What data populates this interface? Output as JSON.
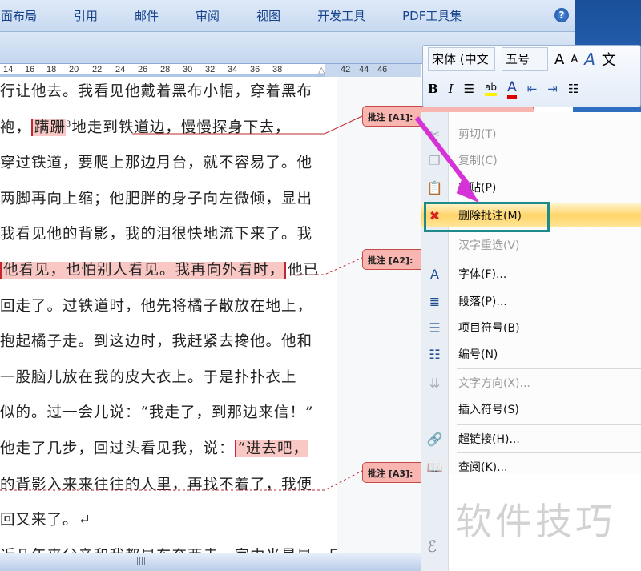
{
  "ribbon": {
    "tabs": [
      "页面布局",
      "引用",
      "邮件",
      "审阅",
      "视图",
      "开发工具",
      "PDF工具集"
    ],
    "help": "?"
  },
  "ruler": {
    "ticks": [
      "14",
      "16",
      "18",
      "20",
      "22",
      "24",
      "26",
      "28",
      "30",
      "32",
      "34",
      "36",
      "38",
      "42",
      "44",
      "46"
    ]
  },
  "document": {
    "lines": [
      {
        "pre": "行让他去。我看见他戴着黑布小帽，穿着黑布"
      },
      {
        "pre": "袍，",
        "hl": "蹒跚",
        "sup": "3",
        "post": "地走到铁道边，慢慢探身下去，"
      },
      {
        "pre": "穿过铁道，要爬上那边月台，就不容易了。他"
      },
      {
        "pre": "两脚再向上缩；他肥胖的身子向左微倾，显出"
      },
      {
        "pre": "我看见他的背影，我的泪很快地流下来了。我"
      },
      {
        "hl": "他看见，也怕别人看见。我再向外看时，",
        "post": "他已"
      },
      {
        "pre": "回走了。过铁道时，他先将橘子散放在地上，"
      },
      {
        "pre": "抱起橘子走。到这边时，我赶紧去搀他。他和"
      },
      {
        "pre": "一股脑儿放在我的皮大衣上。于是扑扑衣上"
      },
      {
        "pre": "似的。过一会儿说：“我走了，到那边来信！”"
      },
      {
        "pre": "他走了几步，回过头看见我，说：",
        "hl": "“进去吧，"
      },
      {
        "pre": "的背影入来来往往的人里，再找不着了，我便"
      },
      {
        "pre": "回又来了。↵"
      },
      {
        "pre": "近几年来父亲和我都是东奔西走，家中光景是一日不如一"
      }
    ]
  },
  "comments": [
    {
      "label": "批注 [A1]:"
    },
    {
      "label": "批注 [A2]:"
    },
    {
      "label": "批注 [A3]:"
    }
  ],
  "mini_toolbar": {
    "font": "宋体 (中文",
    "size": "五号",
    "grow": "A",
    "shrink": "A",
    "style": "A",
    "phonetic": "文",
    "bold": "B",
    "italic": "I",
    "highlight": "ab",
    "color": "A"
  },
  "context_menu": {
    "items": [
      {
        "label": "剪切(T)",
        "disabled": true,
        "icon": "scissors-icon"
      },
      {
        "label": "复制(C)",
        "disabled": true,
        "icon": "copy-icon"
      },
      {
        "label": "粘贴(P)",
        "disabled": false,
        "icon": "paste-icon"
      },
      {
        "label": "删除批注(M)",
        "disabled": false,
        "icon": "delete-comment-icon"
      },
      {
        "label": "汉字重选(V)",
        "disabled": true,
        "icon": ""
      },
      {
        "label": "字体(F)...",
        "disabled": false,
        "icon": "font-icon"
      },
      {
        "label": "段落(P)...",
        "disabled": false,
        "icon": "paragraph-icon"
      },
      {
        "label": "项目符号(B)",
        "disabled": false,
        "icon": "bullets-icon"
      },
      {
        "label": "编号(N)",
        "disabled": false,
        "icon": "numbering-icon"
      },
      {
        "label": "文字方向(X)...",
        "disabled": true,
        "icon": "text-direction-icon"
      },
      {
        "label": "插入符号(S)",
        "disabled": false,
        "icon": ""
      },
      {
        "label": "超链接(H)...",
        "disabled": false,
        "icon": "hyperlink-icon"
      },
      {
        "label": "查阅(K)...",
        "disabled": false,
        "icon": "lookup-icon"
      }
    ]
  },
  "watermark": "软件技巧",
  "colors": {
    "highlight": "#f9c7c4",
    "balloon": "#f9b5b0",
    "selection_box": "#1f8a8a",
    "arrow": "#d633d6"
  }
}
